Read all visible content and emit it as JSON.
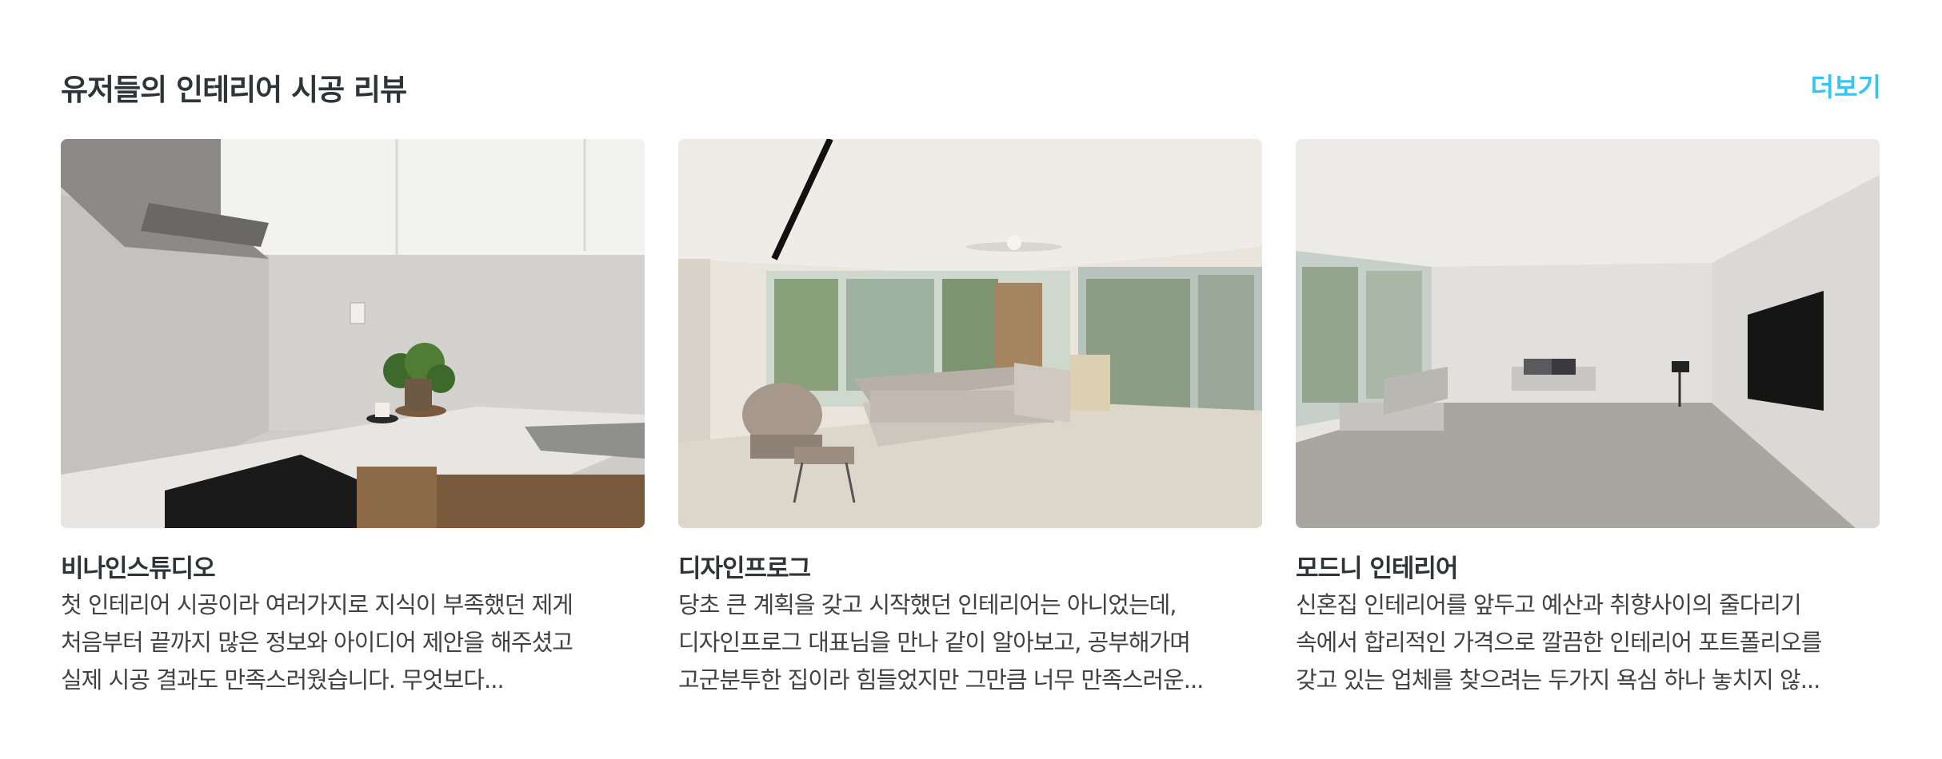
{
  "section": {
    "title": "유저들의 인테리어 시공 리뷰",
    "more_label": "더보기"
  },
  "cards": [
    {
      "company": "비나인스튜디오",
      "lines": [
        "첫 인테리어 시공이라 여러가지로 지식이 부족했던 제게",
        "처음부터 끝까지 많은 정보와 아이디어 제안을 해주셨고",
        "실제 시공 결과도 만족스러웠습니다. 무엇보다..."
      ]
    },
    {
      "company": "디자인프로그",
      "lines": [
        "당초 큰 계획을 갖고 시작했던 인테리어는 아니었는데,",
        "디자인프로그 대표님을 만나 같이 알아보고, 공부해가며",
        "고군분투한 집이라 힘들었지만 그만큼 너무 만족스러운..."
      ]
    },
    {
      "company": "모드니 인테리어",
      "lines": [
        "신혼집 인테리어를 앞두고 예산과 취향사이의 줄다리기",
        "속에서 합리적인 가격으로 깔끔한 인테리어 포트폴리오를",
        "갖고 있는 업체를 찾으려는 두가지 욕심 하나 놓치지 않..."
      ]
    }
  ],
  "colors": {
    "accent": "#35c5f0",
    "title": "#2f3438",
    "body": "#424242"
  }
}
